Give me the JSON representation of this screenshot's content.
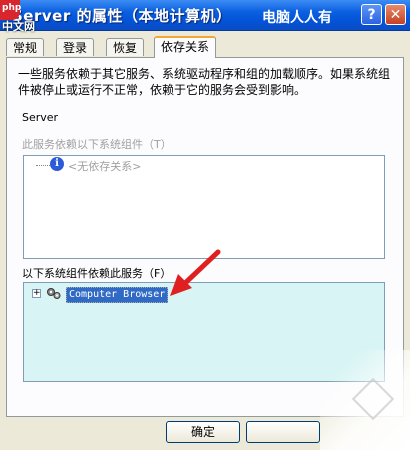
{
  "window": {
    "title": "Server 的属性（本地计算机）",
    "watermark": "电脑人人有",
    "logo_badge": "php",
    "logo_text": "中文网",
    "help_label": "?",
    "close_label": "✕"
  },
  "tabs": [
    {
      "label": "常规"
    },
    {
      "label": "登录"
    },
    {
      "label": "恢复"
    },
    {
      "label": "依存关系",
      "active": true
    }
  ],
  "description": "一些服务依赖于其它服务、系统驱动程序和组的加载顺序。如果系统组件被停止或运行不正常，依赖于它的服务会受到影响。",
  "service_name": "Server",
  "depends_on": {
    "label": "此服务依赖以下系统组件（T）",
    "items": [
      {
        "label": "<无依存关系>",
        "icon": "info-icon"
      }
    ]
  },
  "dependents": {
    "label": "以下系统组件依赖此服务（F）",
    "items": [
      {
        "label": "Computer Browser",
        "icon": "gear-icon",
        "expander": "+",
        "selected": true
      }
    ]
  },
  "buttons": {
    "ok": "确定",
    "cancel": ""
  },
  "colors": {
    "titlebar": "#0a5fe0",
    "selection": "#316ac5",
    "arrow": "#e02020",
    "list_bg": "#d8f4f4"
  }
}
